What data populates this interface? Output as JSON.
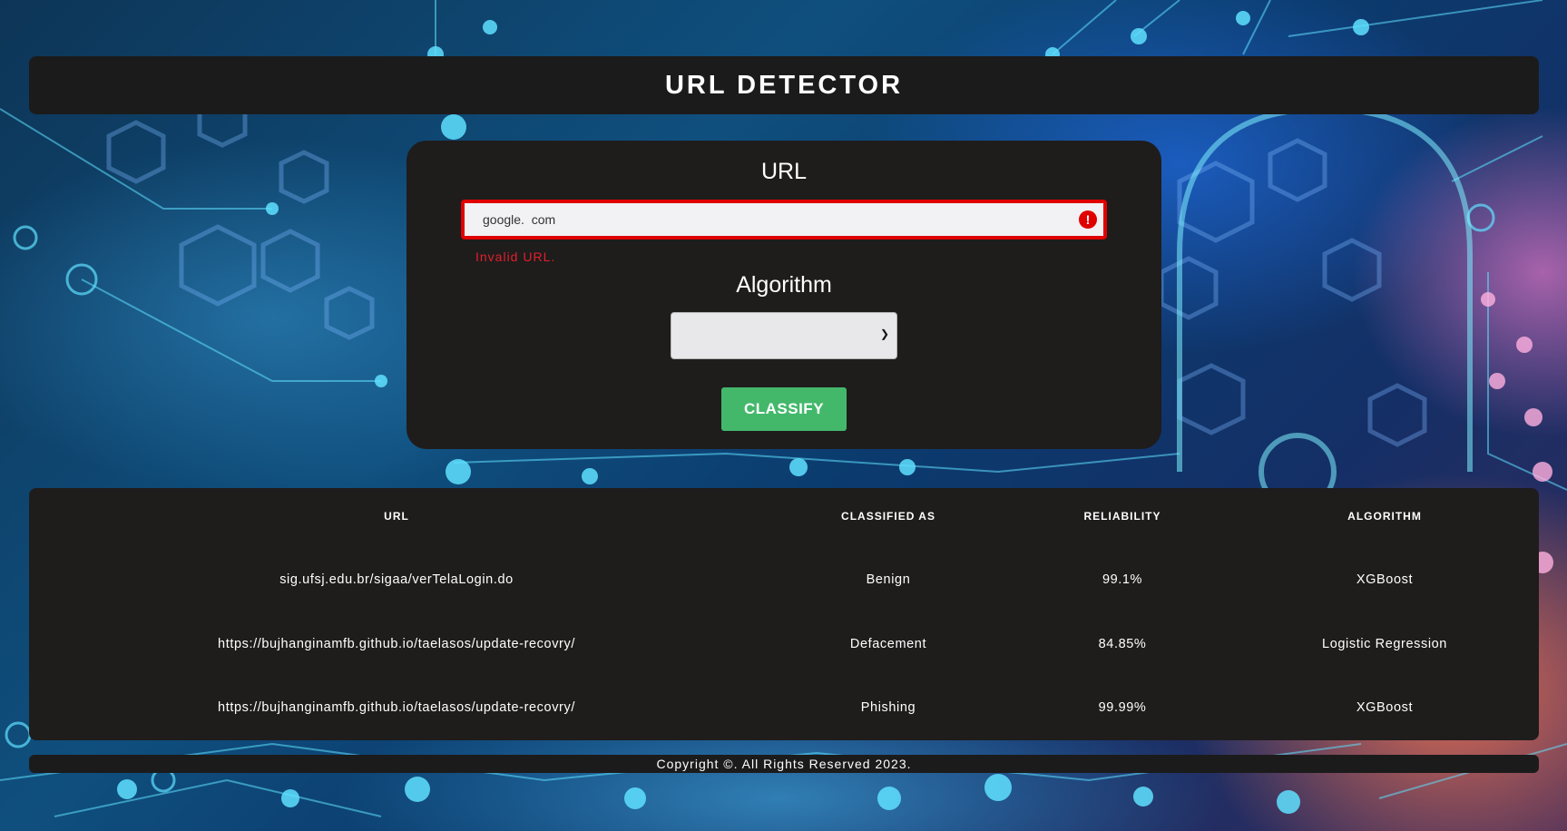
{
  "header": {
    "title": "URL DETECTOR"
  },
  "form": {
    "url_label": "URL",
    "url_value": "google.  com",
    "error_message": "Invalid URL.",
    "algorithm_label": "Algorithm",
    "algorithm_selected": "",
    "classify_label": "CLASSIFY"
  },
  "table": {
    "headers": [
      "URL",
      "CLASSIFIED AS",
      "RELIABILITY",
      "ALGORITHM"
    ],
    "rows": [
      {
        "url": "sig.ufsj.edu.br/sigaa/verTelaLogin.do",
        "classified_as": "Benign",
        "reliability": "99.1%",
        "algorithm": "XGBoost"
      },
      {
        "url": "https://bujhanginamfb.github.io/taelasos/update-recovry/",
        "classified_as": "Defacement",
        "reliability": "84.85%",
        "algorithm": "Logistic Regression"
      },
      {
        "url": "https://bujhanginamfb.github.io/taelasos/update-recovry/",
        "classified_as": "Phishing",
        "reliability": "99.99%",
        "algorithm": "XGBoost"
      }
    ]
  },
  "footer": {
    "text": "Copyright ©. All Rights Reserved 2023."
  },
  "colors": {
    "error": "#e00000",
    "button": "#43b86b",
    "panel": "#1f1c1c"
  }
}
